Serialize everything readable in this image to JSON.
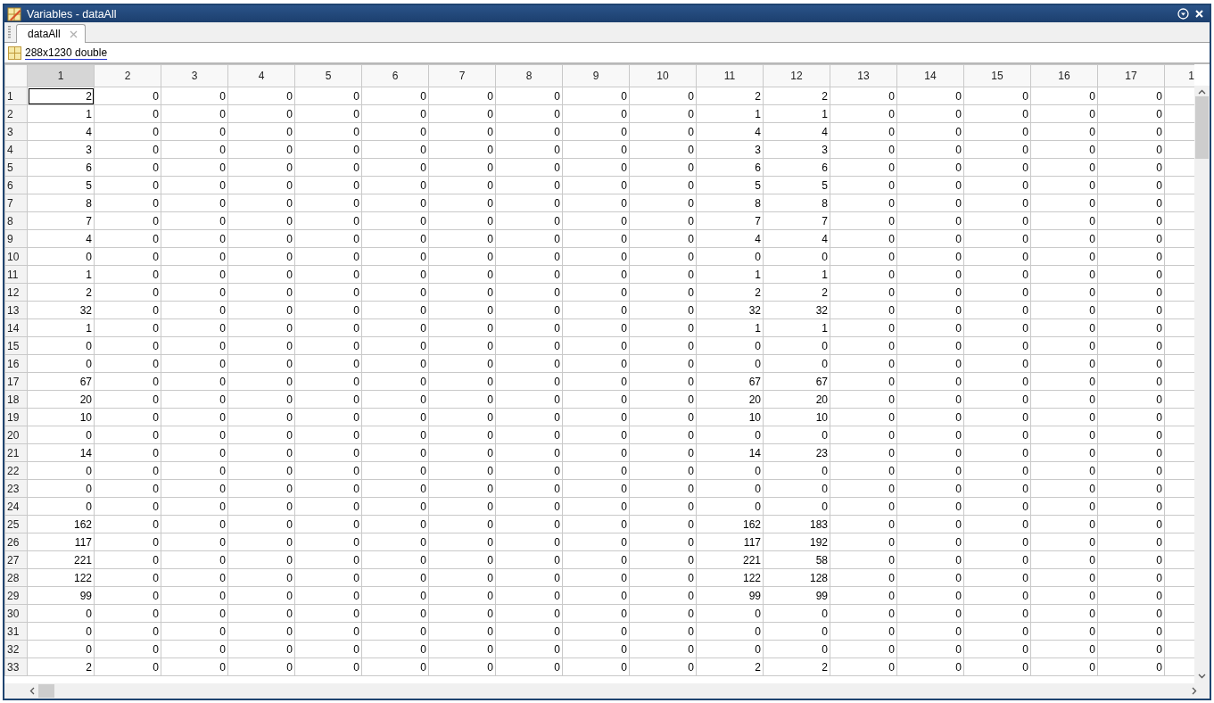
{
  "window": {
    "title": "Variables - dataAll"
  },
  "tabs": [
    {
      "label": "dataAll",
      "selected": true
    }
  ],
  "info": {
    "size_type": "288x1230 double"
  },
  "table": {
    "columns": [
      {
        "label": "1",
        "selected": true
      },
      {
        "label": "2",
        "selected": false
      },
      {
        "label": "3",
        "selected": false
      },
      {
        "label": "4",
        "selected": false
      },
      {
        "label": "5",
        "selected": false
      },
      {
        "label": "6",
        "selected": false
      },
      {
        "label": "7",
        "selected": false
      },
      {
        "label": "8",
        "selected": false
      },
      {
        "label": "9",
        "selected": false
      },
      {
        "label": "10",
        "selected": false
      },
      {
        "label": "11",
        "selected": false
      },
      {
        "label": "12",
        "selected": false
      },
      {
        "label": "13",
        "selected": false
      },
      {
        "label": "14",
        "selected": false
      },
      {
        "label": "15",
        "selected": false
      },
      {
        "label": "16",
        "selected": false
      },
      {
        "label": "17",
        "selected": false
      },
      {
        "label": "1",
        "selected": false
      }
    ],
    "rows": [
      {
        "label": "1",
        "selected": true,
        "cells": [
          "2",
          "0",
          "0",
          "0",
          "0",
          "0",
          "0",
          "0",
          "0",
          "0",
          "2",
          "2",
          "0",
          "0",
          "0",
          "0",
          "0"
        ]
      },
      {
        "label": "2",
        "selected": false,
        "cells": [
          "1",
          "0",
          "0",
          "0",
          "0",
          "0",
          "0",
          "0",
          "0",
          "0",
          "1",
          "1",
          "0",
          "0",
          "0",
          "0",
          "0"
        ]
      },
      {
        "label": "3",
        "selected": false,
        "cells": [
          "4",
          "0",
          "0",
          "0",
          "0",
          "0",
          "0",
          "0",
          "0",
          "0",
          "4",
          "4",
          "0",
          "0",
          "0",
          "0",
          "0"
        ]
      },
      {
        "label": "4",
        "selected": false,
        "cells": [
          "3",
          "0",
          "0",
          "0",
          "0",
          "0",
          "0",
          "0",
          "0",
          "0",
          "3",
          "3",
          "0",
          "0",
          "0",
          "0",
          "0"
        ]
      },
      {
        "label": "5",
        "selected": false,
        "cells": [
          "6",
          "0",
          "0",
          "0",
          "0",
          "0",
          "0",
          "0",
          "0",
          "0",
          "6",
          "6",
          "0",
          "0",
          "0",
          "0",
          "0"
        ]
      },
      {
        "label": "6",
        "selected": false,
        "cells": [
          "5",
          "0",
          "0",
          "0",
          "0",
          "0",
          "0",
          "0",
          "0",
          "0",
          "5",
          "5",
          "0",
          "0",
          "0",
          "0",
          "0"
        ]
      },
      {
        "label": "7",
        "selected": false,
        "cells": [
          "8",
          "0",
          "0",
          "0",
          "0",
          "0",
          "0",
          "0",
          "0",
          "0",
          "8",
          "8",
          "0",
          "0",
          "0",
          "0",
          "0"
        ]
      },
      {
        "label": "8",
        "selected": false,
        "cells": [
          "7",
          "0",
          "0",
          "0",
          "0",
          "0",
          "0",
          "0",
          "0",
          "0",
          "7",
          "7",
          "0",
          "0",
          "0",
          "0",
          "0"
        ]
      },
      {
        "label": "9",
        "selected": false,
        "cells": [
          "4",
          "0",
          "0",
          "0",
          "0",
          "0",
          "0",
          "0",
          "0",
          "0",
          "4",
          "4",
          "0",
          "0",
          "0",
          "0",
          "0"
        ]
      },
      {
        "label": "10",
        "selected": false,
        "cells": [
          "0",
          "0",
          "0",
          "0",
          "0",
          "0",
          "0",
          "0",
          "0",
          "0",
          "0",
          "0",
          "0",
          "0",
          "0",
          "0",
          "0"
        ]
      },
      {
        "label": "11",
        "selected": false,
        "cells": [
          "1",
          "0",
          "0",
          "0",
          "0",
          "0",
          "0",
          "0",
          "0",
          "0",
          "1",
          "1",
          "0",
          "0",
          "0",
          "0",
          "0"
        ]
      },
      {
        "label": "12",
        "selected": false,
        "cells": [
          "2",
          "0",
          "0",
          "0",
          "0",
          "0",
          "0",
          "0",
          "0",
          "0",
          "2",
          "2",
          "0",
          "0",
          "0",
          "0",
          "0"
        ]
      },
      {
        "label": "13",
        "selected": false,
        "cells": [
          "32",
          "0",
          "0",
          "0",
          "0",
          "0",
          "0",
          "0",
          "0",
          "0",
          "32",
          "32",
          "0",
          "0",
          "0",
          "0",
          "0"
        ]
      },
      {
        "label": "14",
        "selected": false,
        "cells": [
          "1",
          "0",
          "0",
          "0",
          "0",
          "0",
          "0",
          "0",
          "0",
          "0",
          "1",
          "1",
          "0",
          "0",
          "0",
          "0",
          "0"
        ]
      },
      {
        "label": "15",
        "selected": false,
        "cells": [
          "0",
          "0",
          "0",
          "0",
          "0",
          "0",
          "0",
          "0",
          "0",
          "0",
          "0",
          "0",
          "0",
          "0",
          "0",
          "0",
          "0"
        ]
      },
      {
        "label": "16",
        "selected": false,
        "cells": [
          "0",
          "0",
          "0",
          "0",
          "0",
          "0",
          "0",
          "0",
          "0",
          "0",
          "0",
          "0",
          "0",
          "0",
          "0",
          "0",
          "0"
        ]
      },
      {
        "label": "17",
        "selected": false,
        "cells": [
          "67",
          "0",
          "0",
          "0",
          "0",
          "0",
          "0",
          "0",
          "0",
          "0",
          "67",
          "67",
          "0",
          "0",
          "0",
          "0",
          "0"
        ]
      },
      {
        "label": "18",
        "selected": false,
        "cells": [
          "20",
          "0",
          "0",
          "0",
          "0",
          "0",
          "0",
          "0",
          "0",
          "0",
          "20",
          "20",
          "0",
          "0",
          "0",
          "0",
          "0"
        ]
      },
      {
        "label": "19",
        "selected": false,
        "cells": [
          "10",
          "0",
          "0",
          "0",
          "0",
          "0",
          "0",
          "0",
          "0",
          "0",
          "10",
          "10",
          "0",
          "0",
          "0",
          "0",
          "0"
        ]
      },
      {
        "label": "20",
        "selected": false,
        "cells": [
          "0",
          "0",
          "0",
          "0",
          "0",
          "0",
          "0",
          "0",
          "0",
          "0",
          "0",
          "0",
          "0",
          "0",
          "0",
          "0",
          "0"
        ]
      },
      {
        "label": "21",
        "selected": false,
        "cells": [
          "14",
          "0",
          "0",
          "0",
          "0",
          "0",
          "0",
          "0",
          "0",
          "0",
          "14",
          "23",
          "0",
          "0",
          "0",
          "0",
          "0"
        ]
      },
      {
        "label": "22",
        "selected": false,
        "cells": [
          "0",
          "0",
          "0",
          "0",
          "0",
          "0",
          "0",
          "0",
          "0",
          "0",
          "0",
          "0",
          "0",
          "0",
          "0",
          "0",
          "0"
        ]
      },
      {
        "label": "23",
        "selected": false,
        "cells": [
          "0",
          "0",
          "0",
          "0",
          "0",
          "0",
          "0",
          "0",
          "0",
          "0",
          "0",
          "0",
          "0",
          "0",
          "0",
          "0",
          "0"
        ]
      },
      {
        "label": "24",
        "selected": false,
        "cells": [
          "0",
          "0",
          "0",
          "0",
          "0",
          "0",
          "0",
          "0",
          "0",
          "0",
          "0",
          "0",
          "0",
          "0",
          "0",
          "0",
          "0"
        ]
      },
      {
        "label": "25",
        "selected": false,
        "cells": [
          "162",
          "0",
          "0",
          "0",
          "0",
          "0",
          "0",
          "0",
          "0",
          "0",
          "162",
          "183",
          "0",
          "0",
          "0",
          "0",
          "0"
        ]
      },
      {
        "label": "26",
        "selected": false,
        "cells": [
          "117",
          "0",
          "0",
          "0",
          "0",
          "0",
          "0",
          "0",
          "0",
          "0",
          "117",
          "192",
          "0",
          "0",
          "0",
          "0",
          "0"
        ]
      },
      {
        "label": "27",
        "selected": false,
        "cells": [
          "221",
          "0",
          "0",
          "0",
          "0",
          "0",
          "0",
          "0",
          "0",
          "0",
          "221",
          "58",
          "0",
          "0",
          "0",
          "0",
          "0"
        ]
      },
      {
        "label": "28",
        "selected": false,
        "cells": [
          "122",
          "0",
          "0",
          "0",
          "0",
          "0",
          "0",
          "0",
          "0",
          "0",
          "122",
          "128",
          "0",
          "0",
          "0",
          "0",
          "0"
        ]
      },
      {
        "label": "29",
        "selected": false,
        "cells": [
          "99",
          "0",
          "0",
          "0",
          "0",
          "0",
          "0",
          "0",
          "0",
          "0",
          "99",
          "99",
          "0",
          "0",
          "0",
          "0",
          "0"
        ]
      },
      {
        "label": "30",
        "selected": false,
        "cells": [
          "0",
          "0",
          "0",
          "0",
          "0",
          "0",
          "0",
          "0",
          "0",
          "0",
          "0",
          "0",
          "0",
          "0",
          "0",
          "0",
          "0"
        ]
      },
      {
        "label": "31",
        "selected": false,
        "cells": [
          "0",
          "0",
          "0",
          "0",
          "0",
          "0",
          "0",
          "0",
          "0",
          "0",
          "0",
          "0",
          "0",
          "0",
          "0",
          "0",
          "0"
        ]
      },
      {
        "label": "32",
        "selected": false,
        "cells": [
          "0",
          "0",
          "0",
          "0",
          "0",
          "0",
          "0",
          "0",
          "0",
          "0",
          "0",
          "0",
          "0",
          "0",
          "0",
          "0",
          "0"
        ]
      },
      {
        "label": "33",
        "selected": false,
        "cells": [
          "2",
          "0",
          "0",
          "0",
          "0",
          "0",
          "0",
          "0",
          "0",
          "0",
          "2",
          "2",
          "0",
          "0",
          "0",
          "0",
          "0"
        ]
      }
    ]
  }
}
